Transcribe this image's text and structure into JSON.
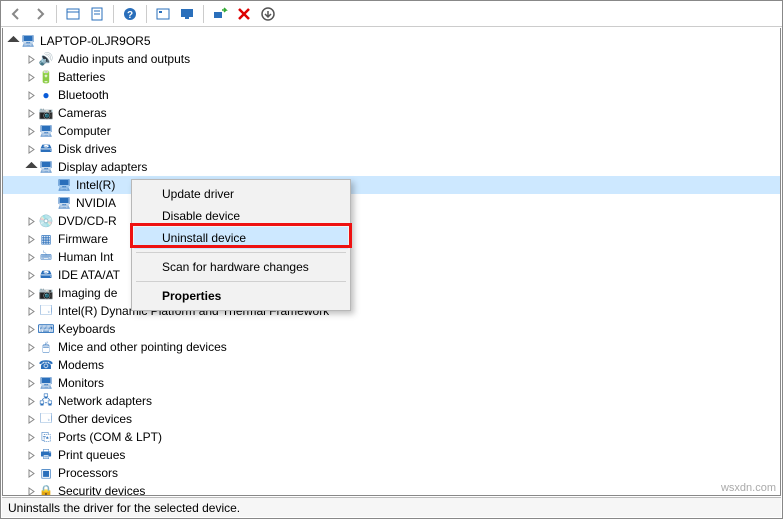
{
  "toolbar": {
    "back": "Back",
    "forward": "Forward",
    "show_hidden": "Show hidden",
    "properties_icon": "Properties",
    "help": "Help",
    "action1": "Action",
    "monitor": "View",
    "scan": "Scan",
    "remove": "Remove",
    "down": "More"
  },
  "root": {
    "label": "LAPTOP-0LJR9OR5"
  },
  "categories": [
    {
      "label": "Audio inputs and outputs",
      "arrow": "closed",
      "icon": "🔊"
    },
    {
      "label": "Batteries",
      "arrow": "closed",
      "icon": "🔋"
    },
    {
      "label": "Bluetooth",
      "arrow": "closed",
      "icon": "●",
      "iconColor": "#0a5cd8"
    },
    {
      "label": "Cameras",
      "arrow": "closed",
      "icon": "📷"
    },
    {
      "label": "Computer",
      "arrow": "closed",
      "icon": "🖥"
    },
    {
      "label": "Disk drives",
      "arrow": "closed",
      "icon": "🖴"
    },
    {
      "label": "Display adapters",
      "arrow": "open",
      "icon": "🖥",
      "children": [
        {
          "label": "Intel(R)",
          "icon": "🖥",
          "selected": true
        },
        {
          "label": "NVIDIA",
          "icon": "🖥"
        }
      ]
    },
    {
      "label": "DVD/CD-R",
      "arrow": "closed",
      "icon": "💿"
    },
    {
      "label": "Firmware",
      "arrow": "closed",
      "icon": "▦"
    },
    {
      "label": "Human Int",
      "arrow": "closed",
      "icon": "🖮"
    },
    {
      "label": "IDE ATA/AT",
      "arrow": "closed",
      "icon": "🖴"
    },
    {
      "label": "Imaging de",
      "arrow": "closed",
      "icon": "📷"
    },
    {
      "label": "Intel(R) Dynamic Platform and Thermal Framework",
      "arrow": "closed",
      "icon": "🗔"
    },
    {
      "label": "Keyboards",
      "arrow": "closed",
      "icon": "⌨"
    },
    {
      "label": "Mice and other pointing devices",
      "arrow": "closed",
      "icon": "🖱"
    },
    {
      "label": "Modems",
      "arrow": "closed",
      "icon": "☎"
    },
    {
      "label": "Monitors",
      "arrow": "closed",
      "icon": "🖥"
    },
    {
      "label": "Network adapters",
      "arrow": "closed",
      "icon": "🖧"
    },
    {
      "label": "Other devices",
      "arrow": "closed",
      "icon": "🗔"
    },
    {
      "label": "Ports (COM & LPT)",
      "arrow": "closed",
      "icon": "⎘"
    },
    {
      "label": "Print queues",
      "arrow": "closed",
      "icon": "🖶"
    },
    {
      "label": "Processors",
      "arrow": "closed",
      "icon": "▣"
    },
    {
      "label": "Security devices",
      "arrow": "closed",
      "icon": "🔒"
    }
  ],
  "context_menu": {
    "update": "Update driver",
    "disable": "Disable device",
    "uninstall": "Uninstall device",
    "scan": "Scan for hardware changes",
    "properties": "Properties"
  },
  "statusbar": {
    "text": "Uninstalls the driver for the selected device."
  },
  "watermark": "wsxdn.com"
}
